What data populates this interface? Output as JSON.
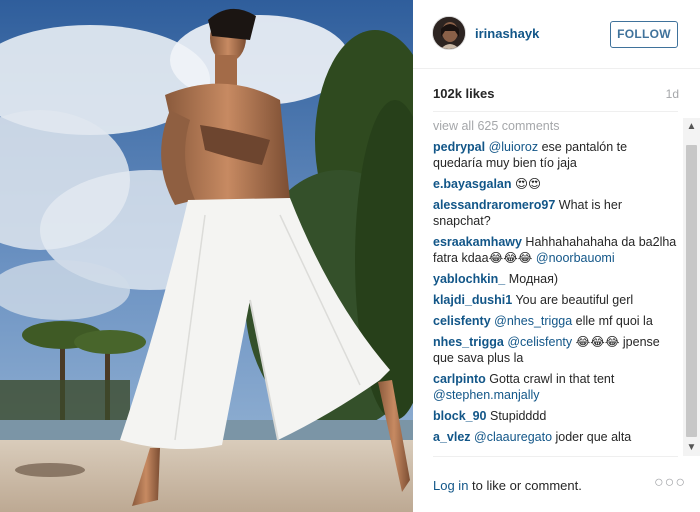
{
  "post": {
    "username": "irinashayk",
    "follow_label": "FOLLOW",
    "likes": "102k likes",
    "age": "1d",
    "view_all": "view all 625 comments"
  },
  "comments": [
    {
      "user": "pedrypal",
      "mention": "@luioroz",
      "text": " ese pantalón te quedaría muy bien tío jaja"
    },
    {
      "user": "e.bayasgalan",
      "text": " 😍😍"
    },
    {
      "user": "alessandraromero97",
      "text": " What is her snapchat?"
    },
    {
      "user": "esraakamhawy",
      "text": " Hahhahahahaha da ba2lha fatra kdaa😂😂😂 ",
      "mention_end": "@noorbauomi"
    },
    {
      "user": "yablochkin_",
      "text": " Модная)"
    },
    {
      "user": "klajdi_dushi1",
      "text": " You are beautiful gerl"
    },
    {
      "user": "celisfenty",
      "mention": "@nhes_trigga",
      "text": " elle mf quoi la"
    },
    {
      "user": "nhes_trigga",
      "mention": "@celisfenty",
      "text": " 😂😂😂 jpense que sava plus la"
    },
    {
      "user": "carlpinto",
      "text": " Gotta crawl in that tent ",
      "mention_end": "@stephen.manjally"
    },
    {
      "user": "block_90",
      "text": " Stupidddd"
    },
    {
      "user": "a_vlez",
      "mention": "@claauregato",
      "text": " joder que alta"
    }
  ],
  "footer": {
    "login_link": "Log in",
    "login_rest": " to like or comment.",
    "more_icon": "ellipsis-icon",
    "more_glyph": "○○○"
  },
  "scroll": {
    "up_glyph": "▲",
    "down_glyph": "▼"
  },
  "colors": {
    "link": "#125688",
    "follow": "#3f729b",
    "muted": "#a5a7aa"
  }
}
